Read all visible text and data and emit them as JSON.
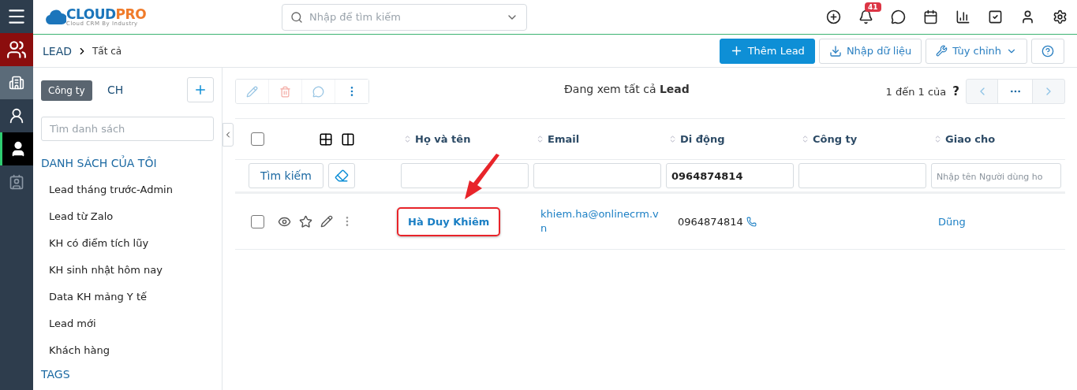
{
  "logo": {
    "text": "CLOUD",
    "accent": "PRO",
    "tagline": "Cloud CRM By Industry"
  },
  "search": {
    "placeholder": "Nhập để tìm kiếm"
  },
  "header_icons": [
    {
      "kind": "add"
    },
    {
      "kind": "bell",
      "badge": "41"
    },
    {
      "kind": "chat"
    },
    {
      "kind": "calendar"
    },
    {
      "kind": "chart"
    },
    {
      "kind": "task"
    },
    {
      "kind": "user"
    },
    {
      "kind": "settings"
    }
  ],
  "rail": [
    {
      "kind": "menu",
      "selected": false,
      "hovered": false,
      "current": false
    },
    {
      "kind": "people",
      "selected": true,
      "hovered": false,
      "current": false
    },
    {
      "kind": "building",
      "selected": false,
      "hovered": true,
      "current": false
    },
    {
      "kind": "agent",
      "selected": false,
      "hovered": false,
      "current": false
    },
    {
      "kind": "person",
      "selected": false,
      "hovered": false,
      "current": true
    },
    {
      "kind": "contact",
      "selected": false,
      "hovered": false,
      "current": false
    }
  ],
  "tooltip": "Công ty",
  "breadcrumb": {
    "module": "LEAD",
    "page": "Tất cả"
  },
  "actions": [
    {
      "kind": "add",
      "label": "Thêm Lead"
    },
    {
      "kind": "import",
      "label": "Nhập dữ liệu"
    },
    {
      "kind": "customize",
      "label": "Tùy chỉnh"
    },
    {
      "kind": "help"
    }
  ],
  "sidebar": {
    "title": "CH",
    "search_placeholder": "Tìm danh sách",
    "section": "DANH SÁCH CỦA TÔI",
    "items": [
      "Lead tháng trước-Admin",
      "Lead từ Zalo",
      "KH có điểm tích lũy",
      "KH sinh nhật hôm nay",
      "Data KH mảng Y tế",
      "Lead mới",
      "Khách hàng"
    ],
    "tags_title": "TAGS"
  },
  "toolbar": [
    {
      "kind": "edit",
      "disabled": true
    },
    {
      "kind": "delete",
      "disabled": true
    },
    {
      "kind": "comment",
      "disabled": true
    },
    {
      "kind": "more",
      "disabled": false
    }
  ],
  "view_title": "Đang xem tất cả **Lead**",
  "pagination": {
    "text": "1 đến 1 của",
    "total": "?"
  },
  "table": {
    "select_all": {
      "checked": false
    },
    "columns": [
      "Họ và tên",
      "Email",
      "Di động",
      "Công ty",
      "Giao cho"
    ],
    "search_button": "Tìm kiếm",
    "filters": [
      {
        "kind": "text"
      },
      {
        "kind": "text"
      },
      {
        "kind": "text",
        "value": "0964874814"
      },
      {
        "kind": "text"
      },
      {
        "kind": "user",
        "placeholder": "Nhập tên Người dùng ho"
      }
    ],
    "rows": [
      {
        "checked": false,
        "name": "Hà Duy Khiêm",
        "highlighted": true,
        "email": "khiem.ha@onlinecrm.vn",
        "phone": "0964874814",
        "company": "",
        "assigned": "Dũng"
      }
    ]
  }
}
